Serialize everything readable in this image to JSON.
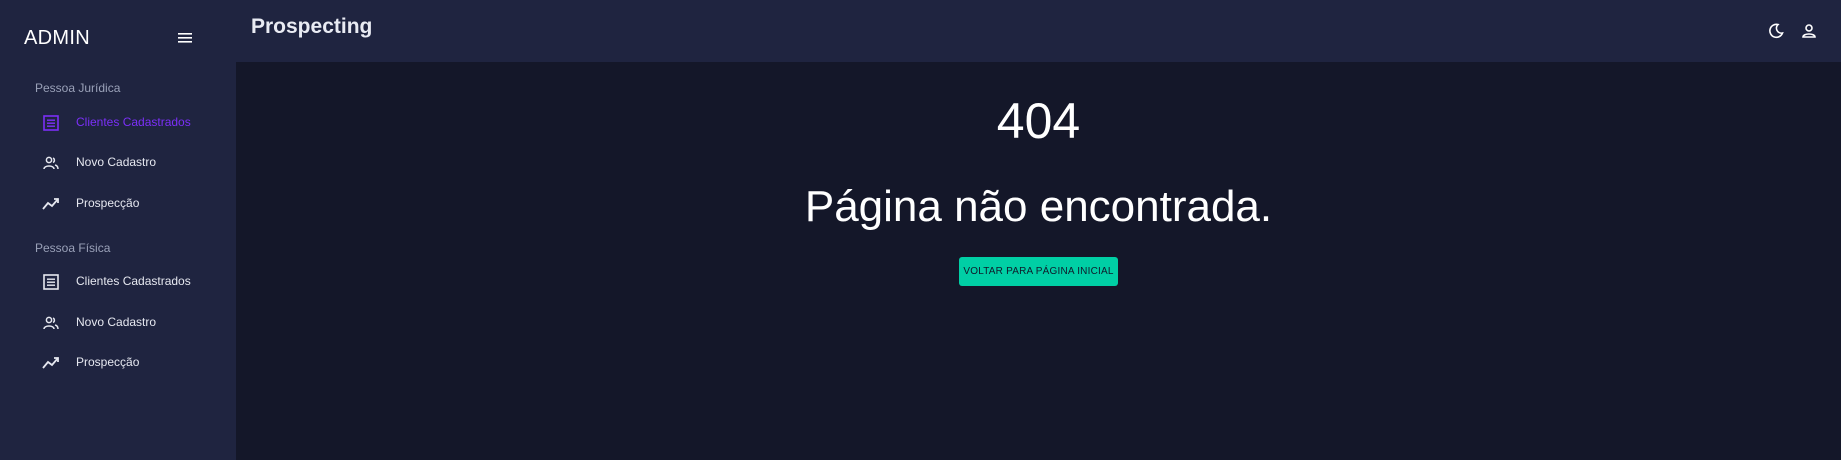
{
  "sidebar": {
    "brand": "ADMIN",
    "sections": [
      {
        "title": "Pessoa Jurídica",
        "items": [
          {
            "label": "Clientes Cadastrados",
            "icon": "list-icon",
            "active": true
          },
          {
            "label": "Novo Cadastro",
            "icon": "people-icon"
          },
          {
            "label": "Prospecção",
            "icon": "trending-up-icon"
          }
        ]
      },
      {
        "title": "Pessoa Física",
        "items": [
          {
            "label": "Clientes Cadastrados",
            "icon": "list-icon"
          },
          {
            "label": "Novo Cadastro",
            "icon": "people-icon"
          },
          {
            "label": "Prospecção",
            "icon": "trending-up-icon"
          }
        ]
      }
    ]
  },
  "header": {
    "title": "Prospecting",
    "icons": [
      "moon-icon",
      "user-icon"
    ]
  },
  "main": {
    "code": "404",
    "message": "Página não encontrada.",
    "button_label": "Voltar para Página Inicial"
  },
  "colors": {
    "background": "#141729",
    "panel": "#1f2440",
    "accent_active": "#7b2ff7",
    "button": "#00cfa5"
  }
}
